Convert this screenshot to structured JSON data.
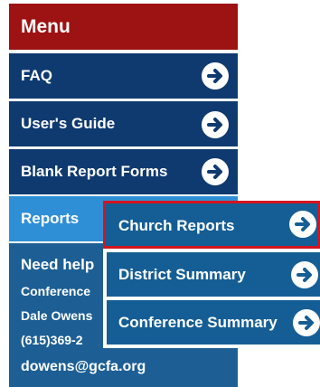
{
  "menu": {
    "title": "Menu",
    "items": [
      {
        "label": "FAQ"
      },
      {
        "label": "User's Guide"
      },
      {
        "label": "Blank Report Forms"
      },
      {
        "label": "Reports"
      }
    ]
  },
  "help": {
    "title": "Need help",
    "line1": "Conference",
    "line2": "Dale Owens",
    "line3": "(615)369-2",
    "email": "dowens@gcfa.org"
  },
  "submenu": {
    "items": [
      {
        "label": "Church Reports"
      },
      {
        "label": "District Summary"
      },
      {
        "label": "Conference Summary"
      }
    ]
  },
  "colors": {
    "header_red": "#9d1212",
    "nav_navy": "#0f3a70",
    "active_blue": "#2f8fd6",
    "submenu_blue": "#155e95",
    "highlight_border": "#d4141e"
  },
  "icons": {
    "nav_arrow": "arrow-right-circle-icon"
  }
}
